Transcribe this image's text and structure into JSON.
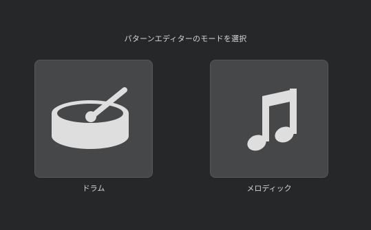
{
  "dialog": {
    "title": "パターンエディターのモードを選択"
  },
  "modes": [
    {
      "id": "drum",
      "label": "ドラム",
      "icon": "drum-icon"
    },
    {
      "id": "melody",
      "label": "メロディック",
      "icon": "music-note-icon"
    }
  ],
  "colors": {
    "background": "#262729",
    "card": "#464749",
    "card_border": "#56575a",
    "icon": "#dedede",
    "text": "#d6d6d6"
  }
}
